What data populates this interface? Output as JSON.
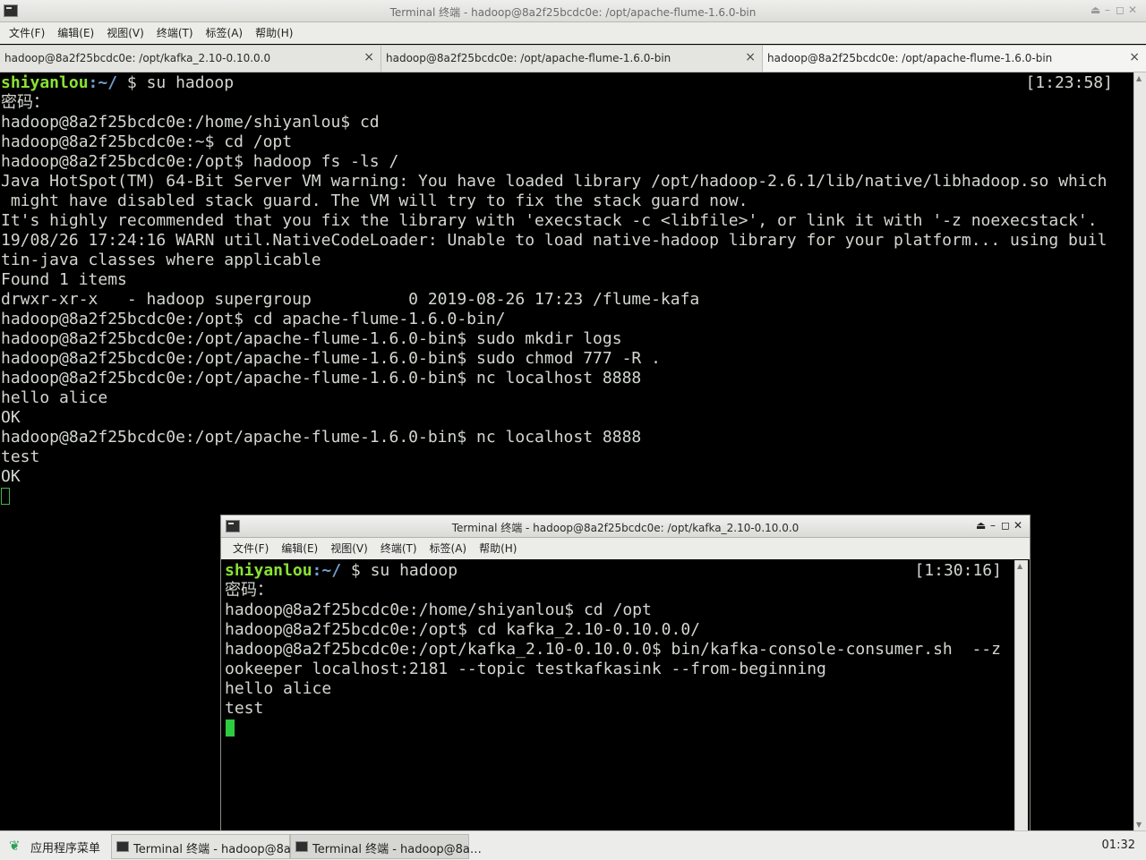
{
  "main_window": {
    "title": "Terminal 终端 - hadoop@8a2f25bcdc0e: /opt/apache-flume-1.6.0-bin",
    "menu": [
      "文件(F)",
      "编辑(E)",
      "视图(V)",
      "终端(T)",
      "标签(A)",
      "帮助(H)"
    ],
    "tabs": [
      {
        "label": "hadoop@8a2f25bcdc0e: /opt/kafka_2.10-0.10.0.0"
      },
      {
        "label": "hadoop@8a2f25bcdc0e: /opt/apache-flume-1.6.0-bin"
      },
      {
        "label": "hadoop@8a2f25bcdc0e: /opt/apache-flume-1.6.0-bin"
      }
    ],
    "tab_close_glyph": "×",
    "clock": "[1:23:58]",
    "prompt_user": "shiyanlou",
    "prompt_path": ":~/",
    "first_command": " $ su hadoop",
    "lines": [
      "密码：",
      "hadoop@8a2f25bcdc0e:/home/shiyanlou$ cd",
      "hadoop@8a2f25bcdc0e:~$ cd /opt",
      "hadoop@8a2f25bcdc0e:/opt$ hadoop fs -ls /",
      "Java HotSpot(TM) 64-Bit Server VM warning: You have loaded library /opt/hadoop-2.6.1/lib/native/libhadoop.so which",
      " might have disabled stack guard. The VM will try to fix the stack guard now.",
      "It's highly recommended that you fix the library with 'execstack -c <libfile>', or link it with '-z noexecstack'.",
      "19/08/26 17:24:16 WARN util.NativeCodeLoader: Unable to load native-hadoop library for your platform... using buil",
      "tin-java classes where applicable",
      "Found 1 items",
      "drwxr-xr-x   - hadoop supergroup          0 2019-08-26 17:23 /flume-kafa",
      "hadoop@8a2f25bcdc0e:/opt$ cd apache-flume-1.6.0-bin/",
      "hadoop@8a2f25bcdc0e:/opt/apache-flume-1.6.0-bin$ sudo mkdir logs",
      "hadoop@8a2f25bcdc0e:/opt/apache-flume-1.6.0-bin$ sudo chmod 777 -R .",
      "hadoop@8a2f25bcdc0e:/opt/apache-flume-1.6.0-bin$ nc localhost 8888",
      "hello alice",
      "OK",
      "hadoop@8a2f25bcdc0e:/opt/apache-flume-1.6.0-bin$ nc localhost 8888",
      "test",
      "OK"
    ]
  },
  "second_window": {
    "title": "Terminal 终端 - hadoop@8a2f25bcdc0e: /opt/kafka_2.10-0.10.0.0",
    "menu": [
      "文件(F)",
      "编辑(E)",
      "视图(V)",
      "终端(T)",
      "标签(A)",
      "帮助(H)"
    ],
    "clock": "[1:30:16]",
    "prompt_user": "shiyanlou",
    "prompt_path": ":~/",
    "first_command": " $ su hadoop",
    "lines": [
      "密码：",
      "hadoop@8a2f25bcdc0e:/home/shiyanlou$ cd /opt",
      "hadoop@8a2f25bcdc0e:/opt$ cd kafka_2.10-0.10.0.0/",
      "hadoop@8a2f25bcdc0e:/opt/kafka_2.10-0.10.0.0$ bin/kafka-console-consumer.sh  --z",
      "ookeeper localhost:2181 --topic testkafkasink --from-beginning",
      "hello alice",
      "test"
    ]
  },
  "taskbar": {
    "app_menu": "应用程序菜单",
    "tasks": [
      {
        "label": "Terminal 终端 - hadoop@8a…"
      },
      {
        "label": "Terminal 终端 - hadoop@8a…"
      }
    ],
    "time": "01:32"
  }
}
